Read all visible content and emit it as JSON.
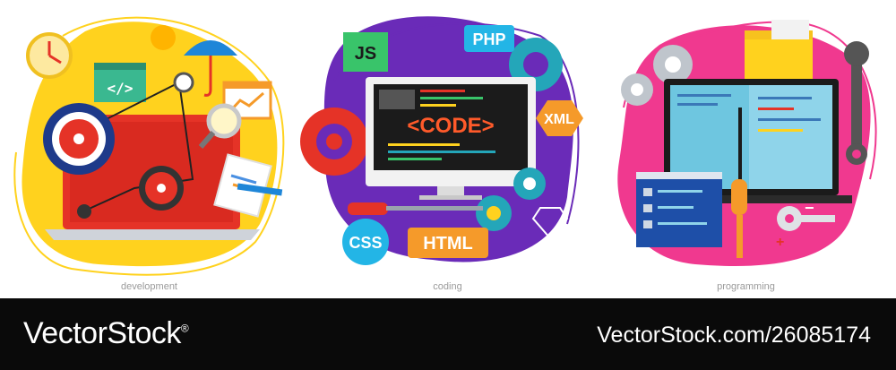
{
  "panels": [
    {
      "caption": "development"
    },
    {
      "caption": "coding",
      "screen_text": "<CODE>",
      "badges": {
        "js": "JS",
        "php": "PHP",
        "xml": "XML",
        "css": "CSS",
        "html": "HTML"
      }
    },
    {
      "caption": "programming"
    }
  ],
  "footer": {
    "brand": "VectorStock",
    "trademark": "®",
    "credit": "VectorStock.com/26085174"
  },
  "colors": {
    "yellow": "#ffd21e",
    "purple": "#6a2bb8",
    "pink": "#f0398f",
    "red": "#e53327",
    "footer": "#0a0a0a"
  },
  "icons": [
    "clock-icon",
    "umbrella-icon",
    "gear-icon",
    "magnifier-icon",
    "wrench-icon",
    "screwdriver-icon",
    "key-icon",
    "diamond-icon",
    "folder-icon",
    "chart-icon"
  ]
}
